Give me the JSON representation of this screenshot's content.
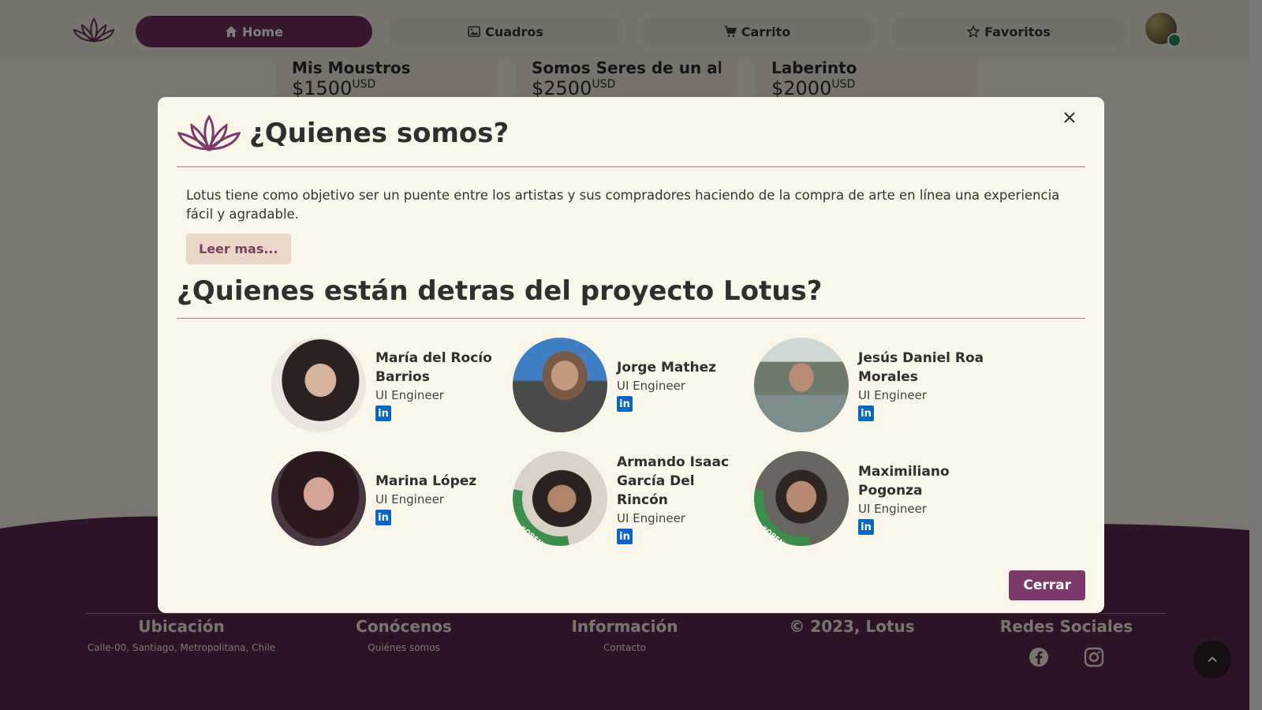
{
  "nav": {
    "items": [
      {
        "label": "Home",
        "icon": "home-icon"
      },
      {
        "label": "Cuadros",
        "icon": "picture-icon"
      },
      {
        "label": "Carrito",
        "icon": "cart-icon"
      },
      {
        "label": "Favoritos",
        "icon": "star-icon"
      }
    ]
  },
  "cards": [
    {
      "title": "Mis Moustros",
      "price": "$1500",
      "currency": "USD"
    },
    {
      "title": "Somos Seres de un al...",
      "price": "$2500",
      "currency": "USD"
    },
    {
      "title": "Laberinto",
      "price": "$2000",
      "currency": "USD"
    }
  ],
  "footer": {
    "location": {
      "title": "Ubicación",
      "text": "Calle-00, Santiago, Metropolitana, Chile"
    },
    "about": {
      "title": "Conócenos",
      "link": "Quiénes somos"
    },
    "info": {
      "title": "Información",
      "link": "Contacto"
    },
    "copyright": "© 2023, Lotus",
    "social": {
      "title": "Redes Sociales"
    }
  },
  "modal": {
    "title": "¿Quienes somos?",
    "about_text": "Lotus tiene como objetivo ser un puente entre los artistas y sus compradores haciendo de la compra de arte en línea una experiencia fácil y agradable.",
    "read_more": "Leer mas...",
    "team_title": "¿Quienes están detras del proyecto Lotus?",
    "close_label": "Cerrar",
    "members": [
      {
        "name": "María del Rocío Barrios",
        "role": "UI Engineer",
        "opentowork": false
      },
      {
        "name": "Jorge Mathez",
        "role": "UI Engineer",
        "opentowork": false
      },
      {
        "name": "Jesús Daniel Roa Morales",
        "role": "UI Engineer",
        "opentowork": false
      },
      {
        "name": "Marina López",
        "role": "UI Engineer",
        "opentowork": false
      },
      {
        "name": "Armando Isaac García Del Rincón",
        "role": "UI Engineer",
        "opentowork": true
      },
      {
        "name": "Maximiliano Pogonza",
        "role": "UI Engineer",
        "opentowork": true
      }
    ],
    "opentowork_label": "#OPENTOWORK",
    "linkedin_label": "in"
  },
  "colors": {
    "brand": "#6d2f5b",
    "footer": "#5a2750",
    "modal_bg": "#fbf6ea",
    "linkedin": "#0a66c2"
  }
}
